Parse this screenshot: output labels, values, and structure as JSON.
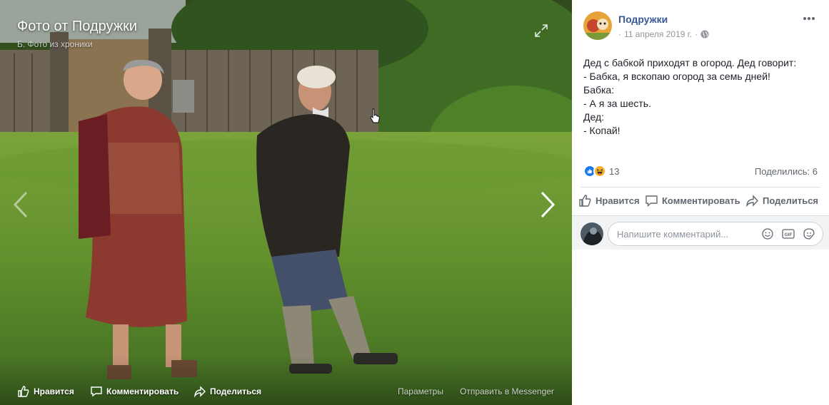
{
  "photo": {
    "title": "Фото от Подружки",
    "subtitle": "Б. Фото из хроники",
    "actions": {
      "like": "Нравится",
      "comment": "Комментировать",
      "share": "Поделиться",
      "params": "Параметры",
      "messenger": "Отправить в Messenger"
    },
    "icons": [
      "expand-icon",
      "chevron-left-icon",
      "chevron-right-icon",
      "hand-cursor-icon"
    ]
  },
  "post": {
    "author": "Подружки",
    "date": "11 апреля 2019 г.",
    "privacy_icon": "globe-icon",
    "text_lines": [
      "Дед с бабкой приходят в огород. Дед говорит:",
      "- Бабка, я вскопаю огород за семь дней!",
      "Бабка:",
      "- А я за шесть.",
      "Дед:",
      "- Копай!"
    ],
    "reactions": {
      "types": [
        "like",
        "haha"
      ],
      "count": "13"
    },
    "shares": "Поделились: 6",
    "actions": {
      "like": "Нравится",
      "comment": "Комментировать",
      "share": "Поделиться"
    },
    "comment_placeholder": "Напишите комментарий...",
    "comment_tools": [
      "emoji-icon",
      "gif-icon",
      "sticker-icon"
    ]
  },
  "colors": {
    "link": "#385898",
    "like_blue": "#1877f2",
    "haha_yellow": "#f7b125",
    "muted": "#606770",
    "grass": "#4c7a2c"
  }
}
